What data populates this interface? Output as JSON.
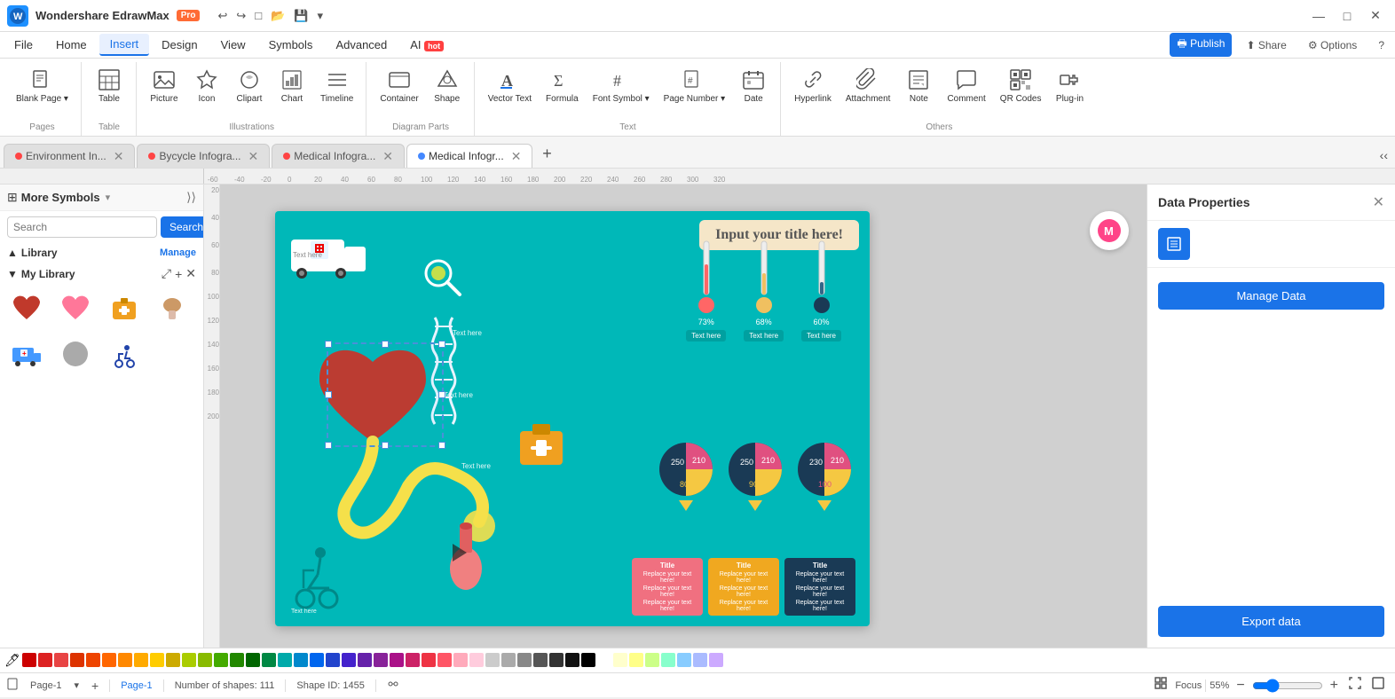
{
  "app": {
    "title": "Wondershare EdrawMax",
    "badge": "Pro",
    "logo_text": "W"
  },
  "titlebar": {
    "undo": "↩",
    "redo": "↪",
    "new": "□",
    "open": "📁",
    "save": "💾",
    "more": "▾",
    "win_minimize": "—",
    "win_maximize": "□",
    "win_close": "✕"
  },
  "menubar": {
    "items": [
      "File",
      "Home",
      "Insert",
      "Design",
      "View",
      "Symbols",
      "Advanced",
      "AI"
    ],
    "active": "Insert",
    "ai_badge": "hot",
    "right": {
      "publish": "🖶 Publish",
      "share": "⬆ Share",
      "options": "⚙ Options",
      "help": "?"
    }
  },
  "ribbon": {
    "groups": [
      {
        "label": "Pages",
        "items": [
          {
            "id": "blank-page",
            "icon": "📄",
            "label": "Blank\nPage",
            "has_arrow": true
          }
        ]
      },
      {
        "label": "Table",
        "items": [
          {
            "id": "table",
            "icon": "⊞",
            "label": "Table"
          }
        ]
      },
      {
        "label": "Illustrations",
        "items": [
          {
            "id": "picture",
            "icon": "🖼",
            "label": "Picture"
          },
          {
            "id": "icon",
            "icon": "★",
            "label": "Icon"
          },
          {
            "id": "clipart",
            "icon": "✂",
            "label": "Clipart"
          },
          {
            "id": "chart",
            "icon": "📊",
            "label": "Chart"
          },
          {
            "id": "timeline",
            "icon": "≡",
            "label": "Timeline"
          }
        ]
      },
      {
        "label": "Diagram Parts",
        "items": [
          {
            "id": "container",
            "icon": "▭",
            "label": "Container"
          },
          {
            "id": "shape",
            "icon": "◈",
            "label": "Shape"
          }
        ]
      },
      {
        "label": "Text",
        "items": [
          {
            "id": "vector-text",
            "icon": "A̲",
            "label": "Vector\nText"
          },
          {
            "id": "formula",
            "icon": "Σ",
            "label": "Formula"
          },
          {
            "id": "font-symbol",
            "icon": "#",
            "label": "Font\nSymbol",
            "has_arrow": true
          },
          {
            "id": "page-number",
            "icon": "⊞",
            "label": "Page\nNumber",
            "has_arrow": true
          },
          {
            "id": "date",
            "icon": "📅",
            "label": "Date"
          }
        ]
      },
      {
        "label": "Others",
        "items": [
          {
            "id": "hyperlink",
            "icon": "🔗",
            "label": "Hyperlink"
          },
          {
            "id": "attachment",
            "icon": "📎",
            "label": "Attachment"
          },
          {
            "id": "note",
            "icon": "📝",
            "label": "Note"
          },
          {
            "id": "comment",
            "icon": "💬",
            "label": "Comment"
          },
          {
            "id": "qr-codes",
            "icon": "⊞",
            "label": "QR\nCodes"
          },
          {
            "id": "plugin",
            "icon": "🧩",
            "label": "Plug-in"
          }
        ]
      }
    ]
  },
  "tabs": {
    "items": [
      {
        "id": "tab1",
        "label": "Environment In...",
        "dot_color": "#ff4444",
        "active": false
      },
      {
        "id": "tab2",
        "label": "Bycycle Infogra...",
        "dot_color": "#ff4444",
        "active": false
      },
      {
        "id": "tab3",
        "label": "Medical Infogra...",
        "dot_color": "#ff4444",
        "active": false
      },
      {
        "id": "tab4",
        "label": "Medical Infogr...",
        "dot_color": "#4488ff",
        "active": true
      }
    ],
    "add_label": "+"
  },
  "left_panel": {
    "title": "More Symbols",
    "search_placeholder": "Search",
    "search_btn": "Search",
    "library_label": "Library",
    "manage_label": "Manage",
    "my_library_label": "My Library",
    "symbols": [
      {
        "id": "heart-organ",
        "color": "#e05050"
      },
      {
        "id": "heart-pink",
        "color": "#ff7788"
      },
      {
        "id": "first-aid",
        "color": "#f0a020"
      },
      {
        "id": "brain",
        "color": "#aa88cc"
      },
      {
        "id": "ambulance",
        "color": "#44aaff"
      },
      {
        "id": "circle-gray",
        "color": "#aaaaaa"
      },
      {
        "id": "wheelchair",
        "color": "#4466cc"
      }
    ]
  },
  "canvas": {
    "title": "Input your title here!",
    "zoom": "55%",
    "page_name": "Page-1"
  },
  "right_panel": {
    "title": "Data Properties",
    "manage_data_btn": "Manage Data",
    "export_data_btn": "Export data"
  },
  "statusbar": {
    "page_label": "Page-1",
    "shapes_count": "Number of shapes: 111",
    "shape_id": "Shape ID: 1455",
    "focus_label": "Focus",
    "zoom_level": "55%"
  },
  "colors": [
    "#cc0000",
    "#dd2222",
    "#e84444",
    "#dd3300",
    "#ee4400",
    "#ff6600",
    "#ff8800",
    "#ffaa00",
    "#ffcc00",
    "#ccaa00",
    "#aacc00",
    "#88bb00",
    "#44aa00",
    "#228800",
    "#006600",
    "#008844",
    "#00aaaa",
    "#0088cc",
    "#0066ee",
    "#2244cc",
    "#4422cc",
    "#6622aa",
    "#882299",
    "#aa1188",
    "#cc2266",
    "#ee3344",
    "#ff5566",
    "#ffaabb",
    "#ffccdd",
    "#cccccc",
    "#aaaaaa",
    "#888888",
    "#555555",
    "#333333",
    "#111111",
    "#000000",
    "#ffffff",
    "#ffffcc",
    "#ffff88",
    "#ccff88",
    "#88ffcc",
    "#88ccff",
    "#aabbff",
    "#ccaaff"
  ],
  "accent": "#1a73e8"
}
